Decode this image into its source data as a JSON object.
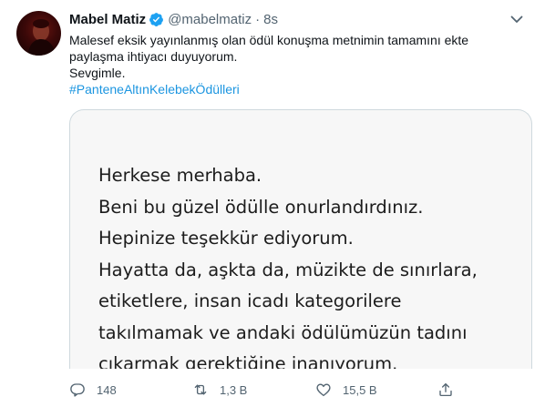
{
  "tweet": {
    "author_name": "Mabel Matiz",
    "handle": "@mabelmatiz",
    "separator": "·",
    "time": "8s",
    "text_lines": [
      "Malesef eksik yayınlanmış olan ödül konuşma metnimin tamamını ekte",
      "paylaşma ihtiyacı duyuyorum.",
      "Sevgimle."
    ],
    "hashtag": "#PanteneAltınKelebekÖdülleri",
    "verified_color": "#1da1f2",
    "link_color": "#1b95e0"
  },
  "media": {
    "lines": [
      "Herkese merhaba.",
      "Beni bu güzel ödülle onurlandırdınız.",
      "Hepinize teşekkür ediyorum.",
      "Hayatta da, aşkta da, müzikte de sınırlara,",
      "etiketlere, insan icadı kategorilere",
      "takılmamak ve andaki ödülümüzün tadını",
      "çıkarmak gerektiğine inanıyorum."
    ]
  },
  "actions": {
    "reply": {
      "icon": "reply-icon",
      "count": "148"
    },
    "retweet": {
      "icon": "retweet-icon",
      "count": "1,3 B"
    },
    "like": {
      "icon": "like-icon",
      "count": "15,5 B"
    },
    "share": {
      "icon": "share-icon"
    }
  }
}
